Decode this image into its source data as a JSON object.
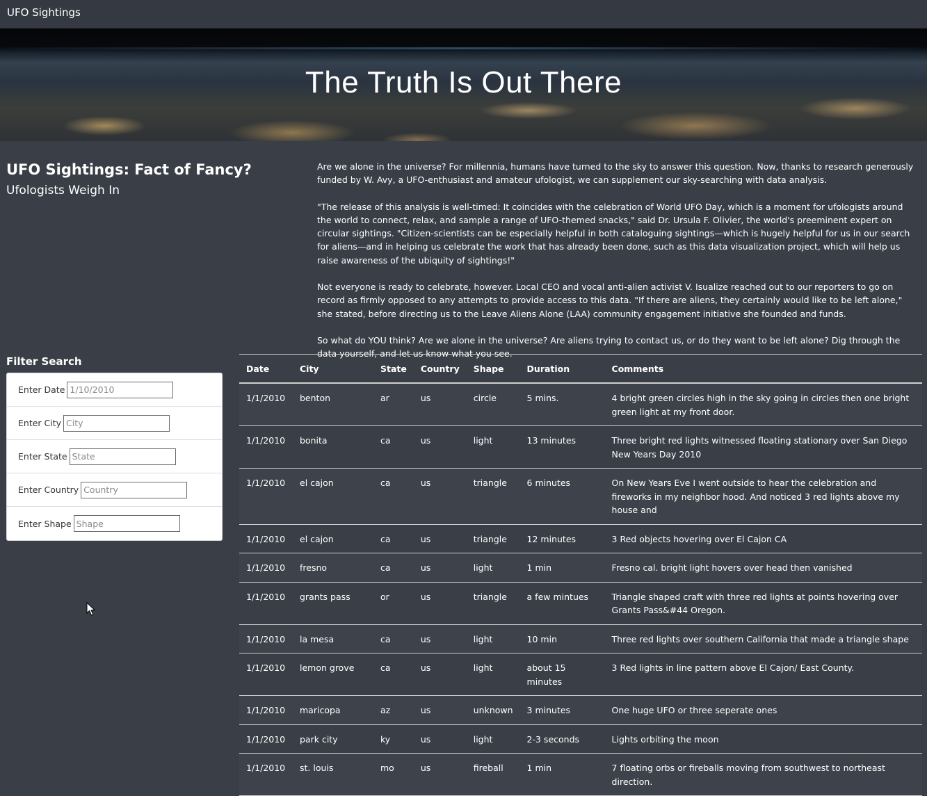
{
  "navbar": {
    "brand": "UFO Sightings"
  },
  "hero": {
    "title": "The Truth Is Out There"
  },
  "headline": {
    "title": "UFO Sightings: Fact of Fancy?",
    "subtitle": "Ufologists Weigh In"
  },
  "article": {
    "paragraphs": [
      "Are we alone in the universe? For millennia, humans have turned to the sky to answer this question. Now, thanks to research generously funded by W. Avy, a UFO-enthusiast and amateur ufologist, we can supplement our sky-searching with data analysis.",
      "\"The release of this analysis is well-timed: It coincides with the celebration of World UFO Day, which is a moment for ufologists around the world to connect, relax, and sample a range of UFO-themed snacks,\" said Dr. Ursula F. Olivier, the world's preeminent expert on circular sightings. \"Citizen-scientists can be especially helpful in both cataloguing sightings—which is hugely helpful for us in our search for aliens—and in helping us celebrate the work that has already been done, such as this data visualization project, which will help us raise awareness of the ubiquity of sightings!\"",
      "Not everyone is ready to celebrate, however. Local CEO and vocal anti-alien activist V. Isualize reached out to our reporters to go on record as firmly opposed to any attempts to provide access to this data. \"If there are aliens, they certainly would like to be left alone,\" she stated, before directing us to the Leave Aliens Alone (LAA) community engagement initiative she founded and funds.",
      "So what do YOU think? Are we alone in the universe? Are aliens trying to contact us, or do they want to be left alone? Dig through the data yourself, and let us know what you see."
    ]
  },
  "filters": {
    "title": "Filter Search",
    "fields": [
      {
        "label": "Enter Date",
        "placeholder": "1/10/2010",
        "value": ""
      },
      {
        "label": "Enter City",
        "placeholder": "City",
        "value": ""
      },
      {
        "label": "Enter State",
        "placeholder": "State",
        "value": ""
      },
      {
        "label": "Enter Country",
        "placeholder": "Country",
        "value": ""
      },
      {
        "label": "Enter Shape",
        "placeholder": "Shape",
        "value": ""
      }
    ]
  },
  "table": {
    "headers": [
      "Date",
      "City",
      "State",
      "Country",
      "Shape",
      "Duration",
      "Comments"
    ],
    "rows": [
      [
        "1/1/2010",
        "benton",
        "ar",
        "us",
        "circle",
        "5 mins.",
        "4 bright green circles high in the sky going in circles then one bright green light at my front door."
      ],
      [
        "1/1/2010",
        "bonita",
        "ca",
        "us",
        "light",
        "13 minutes",
        "Three bright red lights witnessed floating stationary over San Diego New Years Day 2010"
      ],
      [
        "1/1/2010",
        "el cajon",
        "ca",
        "us",
        "triangle",
        "6 minutes",
        "On New Years Eve I went outside to hear the celebration and fireworks in my neighbor hood. And noticed 3 red lights above my house and"
      ],
      [
        "1/1/2010",
        "el cajon",
        "ca",
        "us",
        "triangle",
        "12 minutes",
        "3 Red objects hovering over El Cajon CA"
      ],
      [
        "1/1/2010",
        "fresno",
        "ca",
        "us",
        "light",
        "1 min",
        "Fresno cal. bright light hovers over head then vanished"
      ],
      [
        "1/1/2010",
        "grants pass",
        "or",
        "us",
        "triangle",
        "a few mintues",
        "Triangle shaped craft with three red lights at points hovering over Grants Pass&#44 Oregon."
      ],
      [
        "1/1/2010",
        "la mesa",
        "ca",
        "us",
        "light",
        "10 min",
        "Three red lights over southern California that made a triangle shape"
      ],
      [
        "1/1/2010",
        "lemon grove",
        "ca",
        "us",
        "light",
        "about 15 minutes",
        "3 Red lights in line pattern above El Cajon/ East County."
      ],
      [
        "1/1/2010",
        "maricopa",
        "az",
        "us",
        "unknown",
        "3 minutes",
        "One huge UFO or three seperate ones"
      ],
      [
        "1/1/2010",
        "park city",
        "ky",
        "us",
        "light",
        "2-3 seconds",
        "Lights orbiting the moon"
      ],
      [
        "1/1/2010",
        "st. louis",
        "mo",
        "us",
        "fireball",
        "1 min",
        "7 floating orbs or fireballs moving from southwest to northeast direction."
      ]
    ]
  }
}
